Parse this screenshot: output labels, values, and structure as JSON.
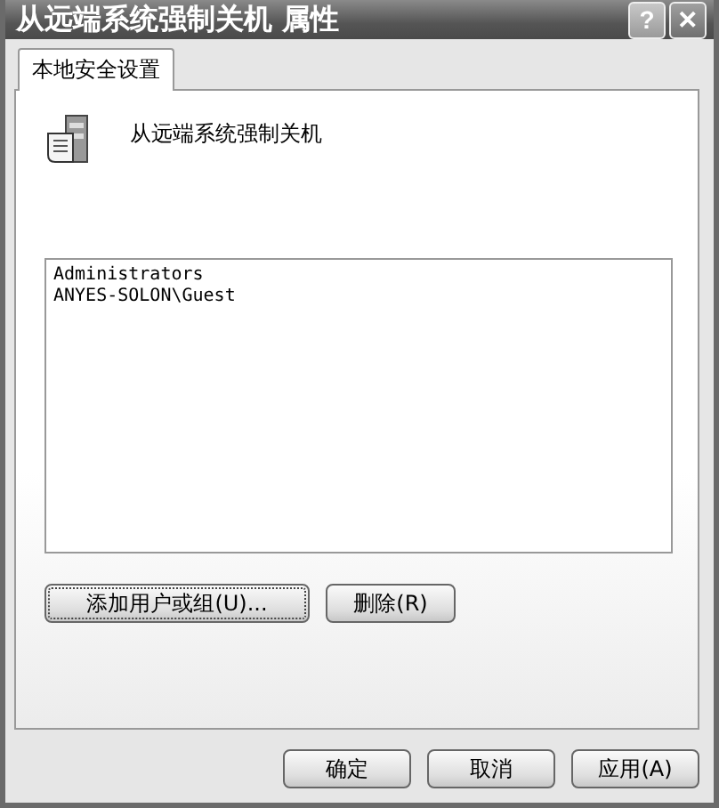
{
  "window": {
    "title": "从远端系统强制关机 属性"
  },
  "title_buttons": [
    {
      "kind": "help",
      "label": "?"
    },
    {
      "kind": "close",
      "label": "✕"
    }
  ],
  "tabs": [
    {
      "label": "本地安全设置",
      "selected": true
    }
  ],
  "policy": {
    "name": "从远端系统强制关机"
  },
  "members": [
    "Administrators",
    "ANYES-SOLON\\Guest"
  ],
  "list_buttons": [
    {
      "label": "添加用户或组(U)...",
      "focused": true
    },
    {
      "label": "删除(R)",
      "focused": false
    }
  ],
  "buttons": [
    "确定",
    "取消",
    "应用(A)"
  ]
}
